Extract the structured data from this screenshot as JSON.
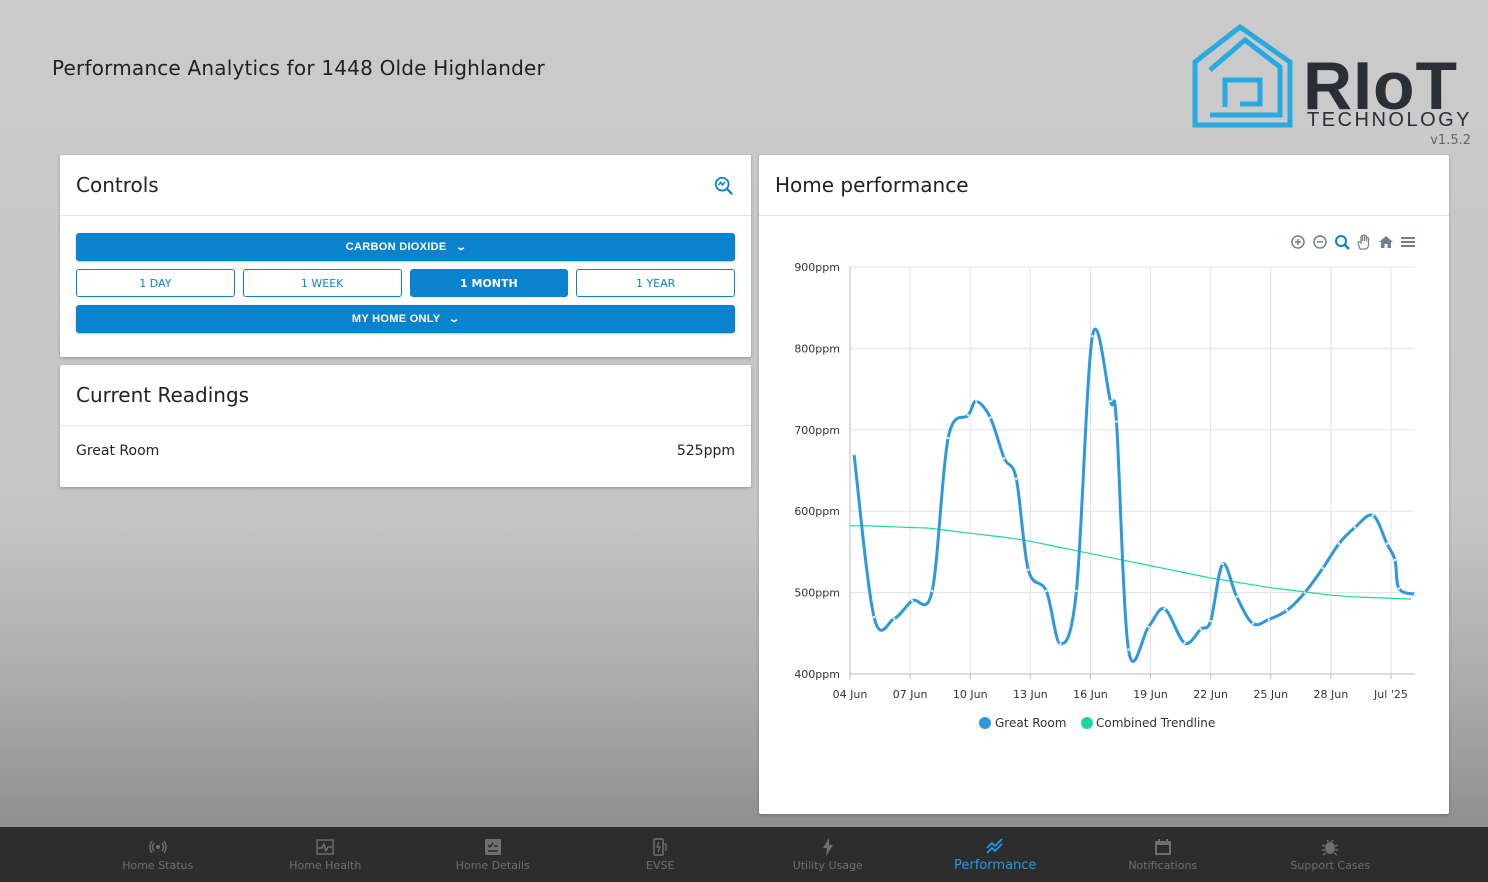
{
  "page": {
    "title": "Performance Analytics for 1448 Olde Highlander"
  },
  "branding": {
    "logo_main": "RIoT",
    "logo_sub": "TECHNOLOGY",
    "version": "v1.5.2",
    "accent_color": "#0a83cf"
  },
  "controls": {
    "title": "Controls",
    "metric_label": "CARBON DIOXIDE",
    "ranges": [
      "1 DAY",
      "1 WEEK",
      "1 MONTH",
      "1 YEAR"
    ],
    "active_range": "1 MONTH",
    "scope_label": "MY HOME ONLY"
  },
  "readings": {
    "title": "Current Readings",
    "items": [
      {
        "room": "Great Room",
        "value": "525ppm"
      }
    ]
  },
  "performance": {
    "title": "Home performance",
    "toolbar": [
      "zoom-in-icon",
      "zoom-out-icon",
      "zoom-selection-icon",
      "pan-icon",
      "reset-home-icon",
      "menu-icon"
    ]
  },
  "chart_data": {
    "type": "line",
    "title": "",
    "xlabel": "",
    "ylabel": "",
    "ylim": [
      400,
      900
    ],
    "y_ticks": [
      400,
      500,
      600,
      700,
      800,
      900
    ],
    "y_tick_suffix": "ppm",
    "x_tick_labels": [
      "04 Jun",
      "07 Jun",
      "10 Jun",
      "13 Jun",
      "16 Jun",
      "19 Jun",
      "22 Jun",
      "25 Jun",
      "28 Jun",
      "Jul '25"
    ],
    "x_tick_days": [
      4,
      7,
      10,
      13,
      16,
      19,
      22,
      25,
      28,
      31
    ],
    "xlim_days": [
      4,
      32.2
    ],
    "grid": true,
    "legend_position": "bottom-center",
    "series": [
      {
        "name": "Great Room",
        "color": "#2f97dd",
        "x": [
          4.2,
          5.2,
          6.2,
          7.1,
          8.1,
          8.9,
          9.9,
          10.3,
          11.0,
          11.7,
          12.3,
          12.9,
          13.8,
          14.5,
          15.3,
          16.1,
          17.0,
          17.3,
          17.9,
          18.9,
          19.7,
          20.7,
          21.5,
          22.0,
          22.6,
          23.3,
          24.1,
          24.9,
          25.8,
          26.7,
          27.6,
          28.4,
          29.2,
          30.1,
          30.8,
          31.2,
          31.4,
          32.2
        ],
        "y": [
          670,
          470,
          468,
          490,
          502,
          690,
          718,
          735,
          715,
          665,
          640,
          528,
          502,
          437,
          502,
          815,
          735,
          710,
          430,
          458,
          480,
          438,
          455,
          465,
          535,
          495,
          462,
          467,
          478,
          500,
          530,
          560,
          580,
          595,
          560,
          540,
          505,
          498
        ]
      },
      {
        "name": "Combined Trendline",
        "color": "#1ed6a1",
        "x": [
          4,
          5,
          6,
          7,
          8,
          9,
          10,
          11,
          12,
          13,
          14,
          15,
          16,
          17,
          18,
          19,
          20,
          21,
          22,
          23,
          24,
          25,
          26,
          27,
          28,
          29,
          30,
          31,
          32
        ],
        "y": [
          582,
          582,
          581,
          580,
          579,
          576,
          573,
          570,
          567,
          563,
          558,
          553,
          548,
          543,
          538,
          533,
          528,
          523,
          518,
          514,
          510,
          506,
          503,
          500,
          497,
          495,
          494,
          493,
          492
        ]
      }
    ]
  },
  "nav": {
    "items": [
      {
        "label": "Home Status",
        "icon": "broadcast-icon"
      },
      {
        "label": "Home Health",
        "icon": "health-chart-icon"
      },
      {
        "label": "Home Details",
        "icon": "details-icon"
      },
      {
        "label": "EVSE",
        "icon": "ev-charger-icon"
      },
      {
        "label": "Utility Usage",
        "icon": "bolt-icon"
      },
      {
        "label": "Performance",
        "icon": "trend-icon"
      },
      {
        "label": "Notifications",
        "icon": "calendar-icon"
      },
      {
        "label": "Support Cases",
        "icon": "bug-icon"
      }
    ],
    "active_label": "Performance"
  }
}
